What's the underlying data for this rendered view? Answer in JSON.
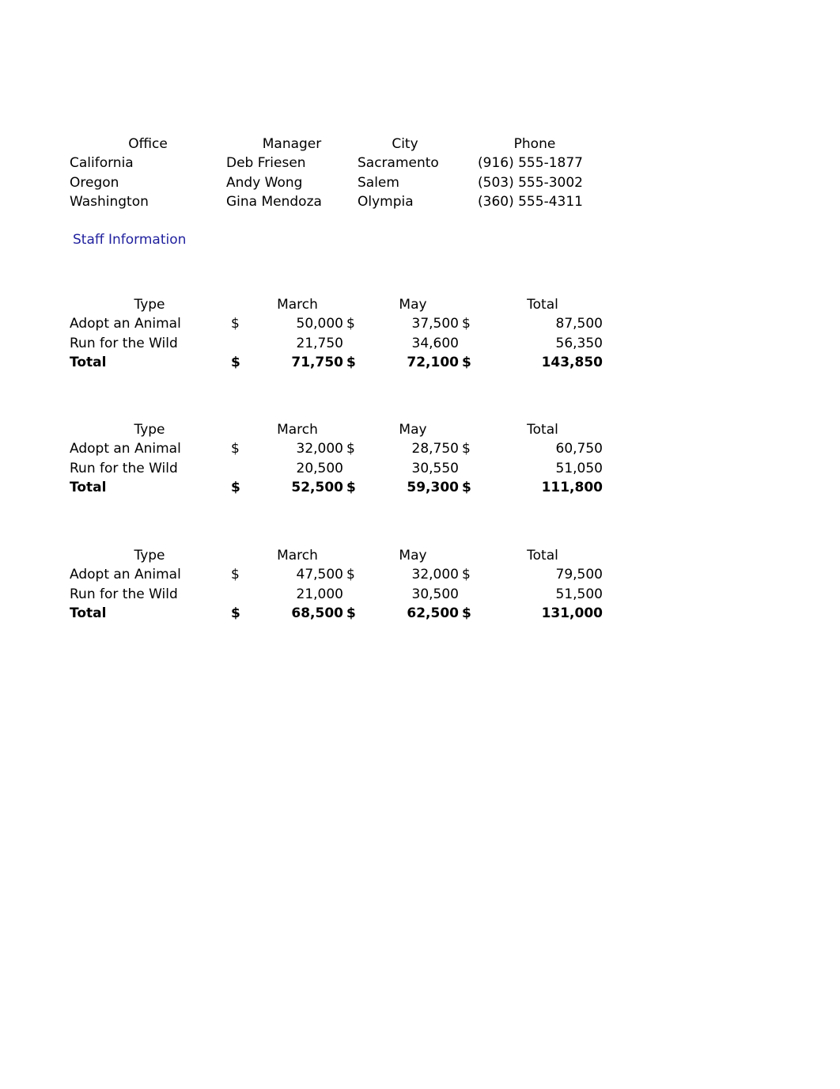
{
  "document": {
    "background_color": "#ffffff",
    "text_color": "#000000",
    "link_color": "#1f1f9e"
  },
  "office_table": {
    "headers": {
      "office": "Office",
      "manager": "Manager",
      "city": "City",
      "phone": "Phone"
    },
    "rows": [
      {
        "office": "California",
        "manager": "Deb Friesen",
        "city": "Sacramento",
        "phone": "(916) 555-1877"
      },
      {
        "office": "Oregon",
        "manager": "Andy Wong",
        "city": "Salem",
        "phone": "(503) 555-3002"
      },
      {
        "office": "Washington",
        "manager": "Gina Mendoza",
        "city": "Olympia",
        "phone": "(360) 555-4311"
      }
    ]
  },
  "staff_link": {
    "label": "Staff Information"
  },
  "financial_blocks": [
    {
      "headers": {
        "type": "Type",
        "march": "March",
        "may": "May",
        "total": "Total"
      },
      "rows": [
        {
          "type": "Adopt an Animal",
          "march_currency": "$",
          "march": "50,000",
          "may_currency": "$",
          "may": "37,500",
          "total_currency": "$",
          "total": "87,500"
        },
        {
          "type": "Run for the Wild",
          "march_currency": "",
          "march": "21,750",
          "may_currency": "",
          "may": "34,600",
          "total_currency": "",
          "total": "56,350"
        }
      ],
      "total_row": {
        "type": "Total",
        "march_currency": "$",
        "march": "71,750",
        "may_currency": "$",
        "may": "72,100",
        "total_currency": "$",
        "total": "143,850"
      }
    },
    {
      "headers": {
        "type": "Type",
        "march": "March",
        "may": "May",
        "total": "Total"
      },
      "rows": [
        {
          "type": "Adopt an Animal",
          "march_currency": "$",
          "march": "32,000",
          "may_currency": "$",
          "may": "28,750",
          "total_currency": "$",
          "total": "60,750"
        },
        {
          "type": "Run for the Wild",
          "march_currency": "",
          "march": "20,500",
          "may_currency": "",
          "may": "30,550",
          "total_currency": "",
          "total": "51,050"
        }
      ],
      "total_row": {
        "type": "Total",
        "march_currency": "$",
        "march": "52,500",
        "may_currency": "$",
        "may": "59,300",
        "total_currency": "$",
        "total": "111,800"
      }
    },
    {
      "headers": {
        "type": "Type",
        "march": "March",
        "may": "May",
        "total": "Total"
      },
      "rows": [
        {
          "type": "Adopt an Animal",
          "march_currency": "$",
          "march": "47,500",
          "may_currency": "$",
          "may": "32,000",
          "total_currency": "$",
          "total": "79,500"
        },
        {
          "type": "Run for the Wild",
          "march_currency": "",
          "march": "21,000",
          "may_currency": "",
          "may": "30,500",
          "total_currency": "",
          "total": "51,500"
        }
      ],
      "total_row": {
        "type": "Total",
        "march_currency": "$",
        "march": "68,500",
        "may_currency": "$",
        "may": "62,500",
        "total_currency": "$",
        "total": "131,000"
      }
    }
  ]
}
